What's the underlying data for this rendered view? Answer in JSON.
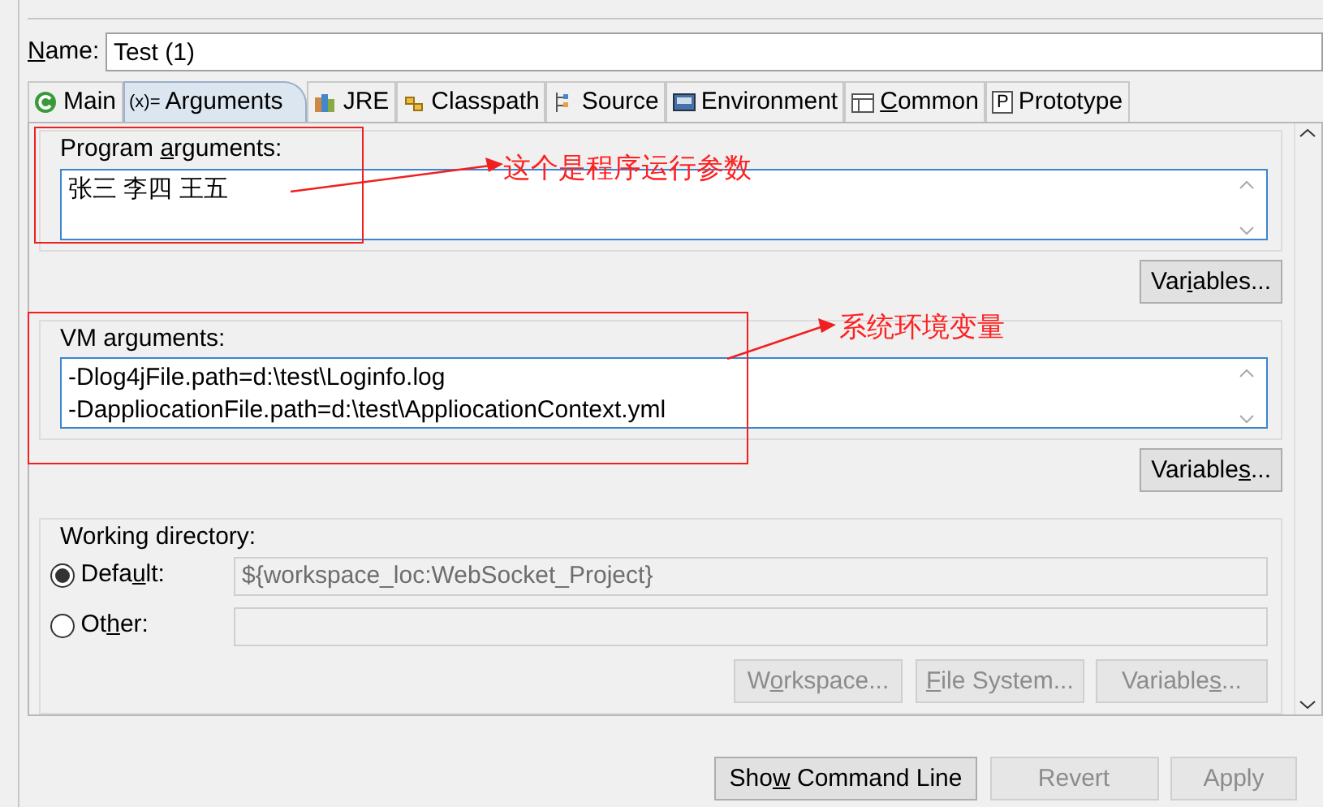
{
  "name_field": {
    "label": {
      "key": "N",
      "after": "ame:"
    },
    "value": "Test (1)"
  },
  "tabs": [
    {
      "label": {
        "before": "Main"
      },
      "selected": false
    },
    {
      "icon_text": "(x)=",
      "label": {
        "before": "Arguments"
      },
      "selected": true
    },
    {
      "label": {
        "before": "JRE"
      },
      "selected": false
    },
    {
      "label": {
        "before": "Classpath"
      },
      "selected": false
    },
    {
      "label": {
        "before": "Source"
      },
      "selected": false
    },
    {
      "label": {
        "before": "Environment"
      },
      "selected": false
    },
    {
      "label": {
        "key": "C",
        "after": "ommon"
      },
      "selected": false
    },
    {
      "icon_text": "P",
      "label": {
        "before": "Prototype"
      },
      "selected": false
    }
  ],
  "program_arguments": {
    "label": {
      "before": "Program ",
      "key": "a",
      "after": "rguments:"
    },
    "value": "张三 李四 王五",
    "button": {
      "before": "Var",
      "key": "i",
      "after": "ables..."
    }
  },
  "vm_arguments": {
    "label": {
      "before": "VM arguments:"
    },
    "value": "-Dlog4jFile.path=d:\\test\\Loginfo.log\n-DappliocationFile.path=d:\\test\\AppliocationContext.yml",
    "button": {
      "before": "Variable",
      "key": "s",
      "after": "..."
    }
  },
  "working_directory": {
    "label": "Working directory:",
    "options": [
      {
        "label": {
          "before": "Defa",
          "key": "u",
          "after": "lt:"
        },
        "selected": true,
        "field_disabled": true,
        "value": "${workspace_loc:WebSocket_Project}"
      },
      {
        "label": {
          "before": "Ot",
          "key": "h",
          "after": "er:"
        },
        "selected": false,
        "field_disabled": true
      }
    ],
    "buttons": [
      {
        "label": {
          "before": "W",
          "key": "o",
          "after": "rkspace..."
        },
        "disabled": true
      },
      {
        "label": {
          "key": "F",
          "after": "ile System..."
        },
        "disabled": true
      },
      {
        "label": {
          "before": "Variable",
          "key": "s",
          "after": "..."
        },
        "disabled": true
      }
    ]
  },
  "footer_buttons": [
    {
      "label": {
        "before": "Sho",
        "key": "w",
        "after": " Command Line"
      },
      "disabled": false
    },
    {
      "label": {
        "before": "Revert"
      },
      "disabled": true
    },
    {
      "label": {
        "before": "Apply"
      },
      "disabled": true
    }
  ],
  "annotations": [
    {
      "text": "这个是程序运行参数"
    },
    {
      "text": "系统环境变量"
    }
  ]
}
